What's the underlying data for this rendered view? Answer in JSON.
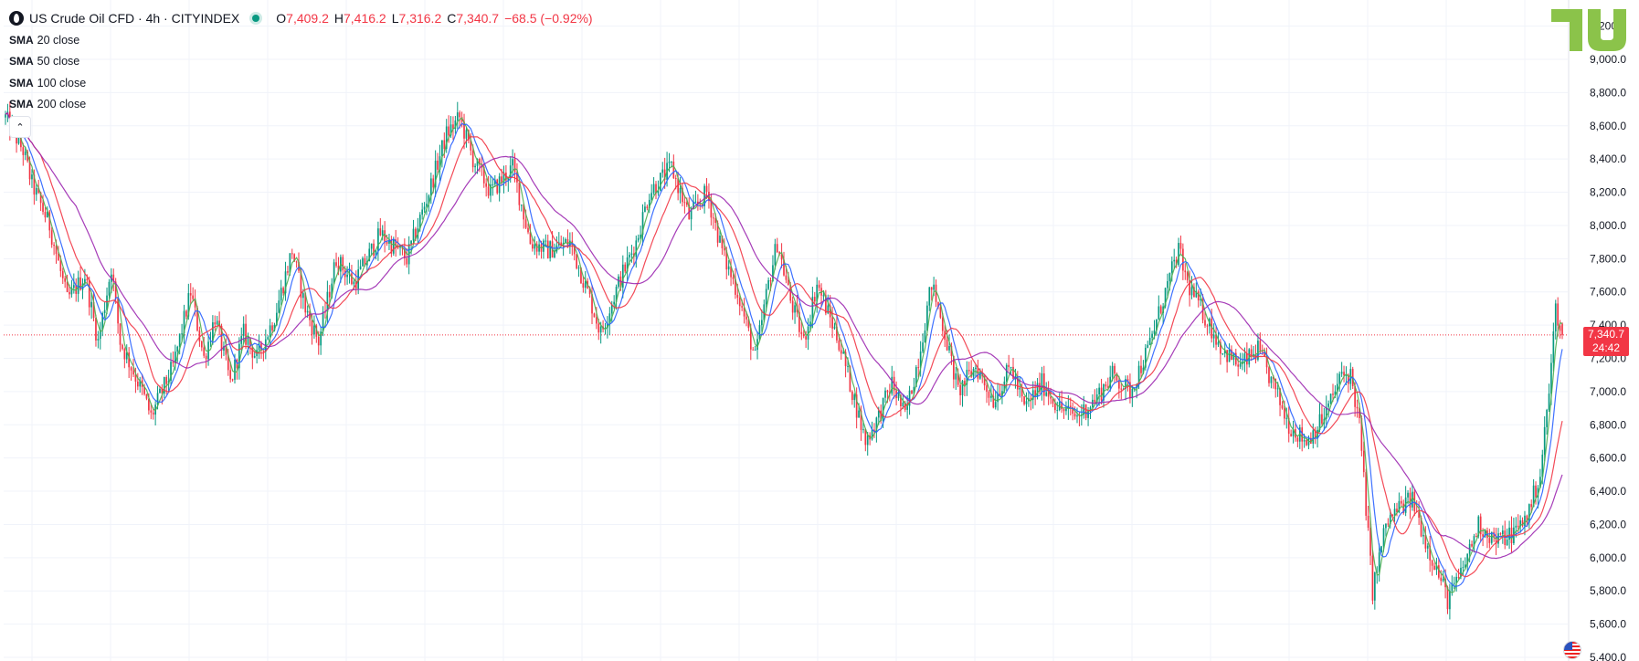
{
  "legend": {
    "symbol_title": "US Crude Oil CFD · 4h · CITYINDEX",
    "open_label": "O",
    "open_value": "7,409.2",
    "high_label": "H",
    "high_value": "7,416.2",
    "low_label": "L",
    "low_value": "7,316.2",
    "close_label": "C",
    "close_value": "7,340.7",
    "change": "−68.5 (−0.92%)",
    "indicators": [
      {
        "kind": "SMA",
        "label": "20 close"
      },
      {
        "kind": "SMA",
        "label": "50 close"
      },
      {
        "kind": "SMA",
        "label": "100 close"
      },
      {
        "kind": "SMA",
        "label": "200 close"
      }
    ]
  },
  "price_tag": {
    "price": "7,340.7",
    "countdown": "24:42"
  },
  "icons": {
    "symbol_logo": "oil-drop-icon",
    "collapse": "chevron-up-icon",
    "brand": "tradingview-logo",
    "country_flag": "us-flag-icon"
  },
  "colors": {
    "up": "#089981",
    "down": "#f23645",
    "sma20": "#4caf50",
    "sma50": "#2962ff",
    "sma100": "#f23645",
    "sma200": "#9c27b0",
    "last_price_line": "#f23645",
    "brand": "#8bc34a"
  },
  "chart_data": {
    "type": "candlestick",
    "title": "US Crude Oil CFD · 4h · CITYINDEX",
    "ylim": [
      5400,
      9200
    ],
    "y_ticks": [
      "5,400.0",
      "5,600.0",
      "5,800.0",
      "6,000.0",
      "6,200.0",
      "6,400.0",
      "6,600.0",
      "6,800.0",
      "7,000.0",
      "7,200.0",
      "7,400.0",
      "7,600.0",
      "7,800.0",
      "8,000.0",
      "8,200.0",
      "8,400.0",
      "8,600.0",
      "8,800.0",
      "9,000.0",
      "9,200.0"
    ],
    "last_price": 7340.7,
    "grid": true,
    "series": [
      {
        "name": "SMA 20 close",
        "period": 20
      },
      {
        "name": "SMA 50 close",
        "period": 50
      },
      {
        "name": "SMA 100 close",
        "period": 100
      },
      {
        "name": "SMA 200 close",
        "period": 200
      }
    ],
    "price_path": [
      [
        0,
        8650
      ],
      [
        8,
        8450
      ],
      [
        12,
        8250
      ],
      [
        20,
        8000
      ],
      [
        28,
        7550
      ],
      [
        36,
        7700
      ],
      [
        42,
        7300
      ],
      [
        48,
        7750
      ],
      [
        52,
        7300
      ],
      [
        62,
        7000
      ],
      [
        66,
        6850
      ],
      [
        76,
        7150
      ],
      [
        84,
        7600
      ],
      [
        90,
        7200
      ],
      [
        95,
        7450
      ],
      [
        102,
        7050
      ],
      [
        108,
        7350
      ],
      [
        114,
        7200
      ],
      [
        122,
        7450
      ],
      [
        130,
        7850
      ],
      [
        136,
        7500
      ],
      [
        142,
        7300
      ],
      [
        150,
        7800
      ],
      [
        158,
        7650
      ],
      [
        170,
        7950
      ],
      [
        182,
        7800
      ],
      [
        192,
        8200
      ],
      [
        200,
        8550
      ],
      [
        206,
        8650
      ],
      [
        212,
        8400
      ],
      [
        220,
        8200
      ],
      [
        230,
        8350
      ],
      [
        238,
        7900
      ],
      [
        246,
        7850
      ],
      [
        256,
        7900
      ],
      [
        264,
        7600
      ],
      [
        270,
        7350
      ],
      [
        278,
        7650
      ],
      [
        286,
        7900
      ],
      [
        292,
        8200
      ],
      [
        302,
        8350
      ],
      [
        310,
        8050
      ],
      [
        318,
        8200
      ],
      [
        326,
        7800
      ],
      [
        332,
        7600
      ],
      [
        340,
        7200
      ],
      [
        346,
        7650
      ],
      [
        350,
        7900
      ],
      [
        356,
        7550
      ],
      [
        362,
        7300
      ],
      [
        368,
        7650
      ],
      [
        378,
        7300
      ],
      [
        384,
        7000
      ],
      [
        390,
        6700
      ],
      [
        396,
        6850
      ],
      [
        402,
        7050
      ],
      [
        408,
        6850
      ],
      [
        414,
        7200
      ],
      [
        420,
        7650
      ],
      [
        426,
        7350
      ],
      [
        432,
        7000
      ],
      [
        440,
        7150
      ],
      [
        448,
        6950
      ],
      [
        456,
        7150
      ],
      [
        462,
        6900
      ],
      [
        470,
        7050
      ],
      [
        478,
        6900
      ],
      [
        486,
        6850
      ],
      [
        494,
        6950
      ],
      [
        502,
        7100
      ],
      [
        510,
        7000
      ],
      [
        518,
        7250
      ],
      [
        526,
        7600
      ],
      [
        532,
        7850
      ],
      [
        536,
        7650
      ],
      [
        544,
        7450
      ],
      [
        552,
        7250
      ],
      [
        560,
        7150
      ],
      [
        568,
        7250
      ],
      [
        576,
        7000
      ],
      [
        582,
        6800
      ],
      [
        590,
        6700
      ],
      [
        598,
        6850
      ],
      [
        606,
        7100
      ],
      [
        610,
        7100
      ],
      [
        614,
        6800
      ],
      [
        620,
        5800
      ],
      [
        626,
        6200
      ],
      [
        632,
        6300
      ],
      [
        638,
        6350
      ],
      [
        644,
        6100
      ],
      [
        650,
        5900
      ],
      [
        654,
        5750
      ],
      [
        660,
        5900
      ],
      [
        668,
        6200
      ],
      [
        676,
        6100
      ],
      [
        684,
        6150
      ],
      [
        690,
        6250
      ],
      [
        696,
        6500
      ],
      [
        700,
        7000
      ],
      [
        703,
        7500
      ],
      [
        706,
        7350
      ]
    ],
    "n_candles": 707
  }
}
